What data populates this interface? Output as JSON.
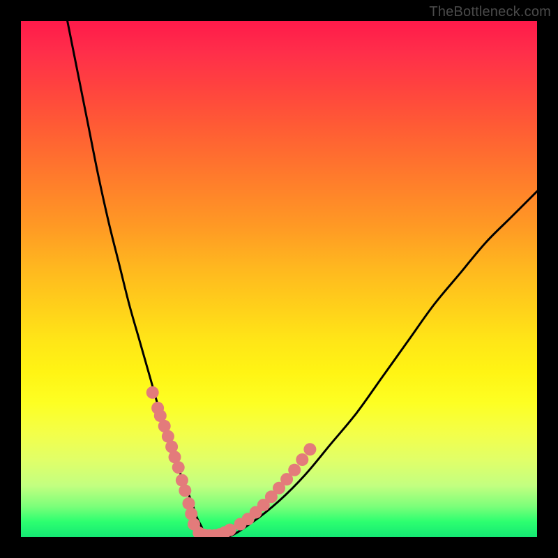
{
  "watermark": {
    "text": "TheBottleneck.com"
  },
  "chart_data": {
    "type": "line",
    "title": "",
    "xlabel": "",
    "ylabel": "",
    "xlim": [
      0,
      100
    ],
    "ylim": [
      0,
      100
    ],
    "grid": false,
    "legend": false,
    "background": "rainbow-gradient-red-top-green-bottom",
    "series": [
      {
        "name": "curve",
        "color": "#000000",
        "x": [
          9,
          11,
          13,
          15,
          17,
          19,
          21,
          23,
          25,
          27,
          29,
          31,
          33,
          34,
          35,
          36,
          40,
          45,
          50,
          55,
          60,
          65,
          70,
          75,
          80,
          85,
          90,
          95,
          100
        ],
        "values": [
          100,
          90,
          80,
          70,
          61,
          53,
          45,
          38,
          31,
          24,
          18,
          12,
          7,
          4,
          2,
          0,
          0,
          3,
          7,
          12,
          18,
          24,
          31,
          38,
          45,
          51,
          57,
          62,
          67
        ]
      },
      {
        "name": "dot-cluster-left",
        "type": "scatter",
        "color": "#e37b7b",
        "x": [
          25.5,
          26.5,
          27.0,
          27.8,
          28.5,
          29.2,
          29.8,
          30.5,
          31.2,
          31.8,
          32.5,
          33.0,
          33.5
        ],
        "values": [
          28.0,
          25.0,
          23.5,
          21.5,
          19.5,
          17.5,
          15.5,
          13.5,
          11.0,
          9.0,
          6.5,
          4.5,
          2.5
        ]
      },
      {
        "name": "dot-cluster-bottom",
        "type": "scatter",
        "color": "#e37b7b",
        "x": [
          34.5,
          35.5,
          36.5,
          37.5,
          38.5,
          39.5,
          40.5
        ],
        "values": [
          0.8,
          0.4,
          0.3,
          0.3,
          0.5,
          0.9,
          1.4
        ]
      },
      {
        "name": "dot-cluster-right",
        "type": "scatter",
        "color": "#e37b7b",
        "x": [
          42.5,
          44.0,
          45.5,
          47.0,
          48.5,
          50.0,
          51.5,
          53.0,
          54.5,
          56.0
        ],
        "values": [
          2.5,
          3.5,
          4.8,
          6.2,
          7.8,
          9.5,
          11.2,
          13.0,
          15.0,
          17.0
        ]
      }
    ]
  }
}
